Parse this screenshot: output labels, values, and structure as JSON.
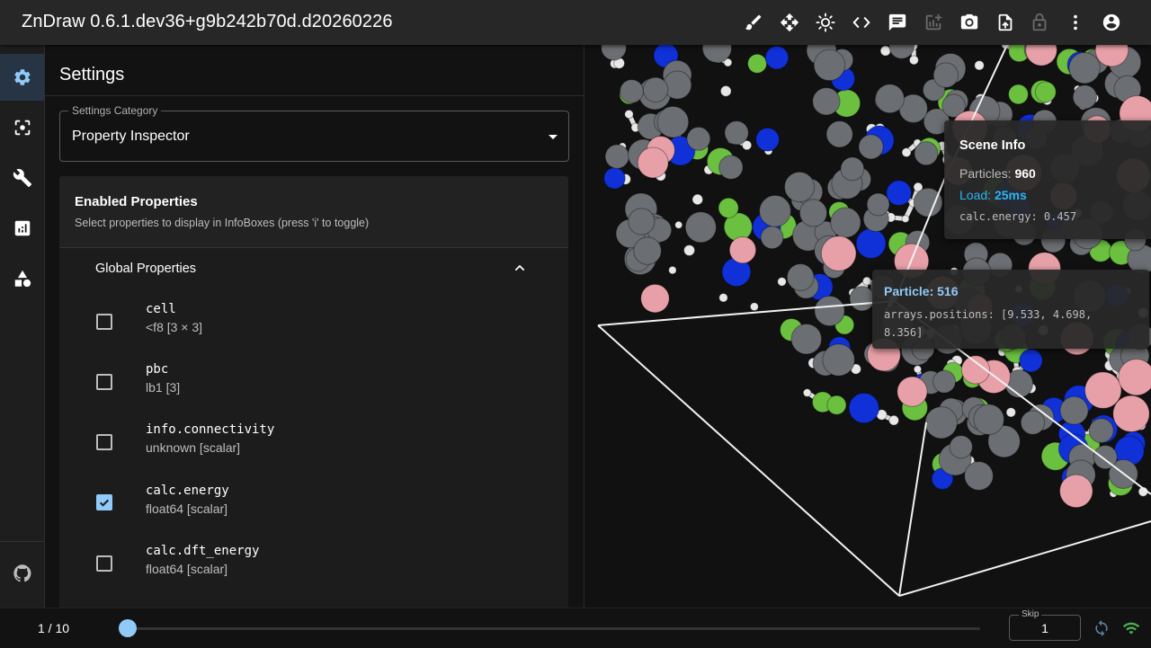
{
  "app": {
    "title": "ZnDraw 0.6.1.dev36+g9b242b70d.d20260226"
  },
  "toolbar": {
    "icons": [
      "brush-icon",
      "move-icon",
      "brightness-icon",
      "code-icon",
      "chat-icon",
      "add-chart-icon",
      "camera-icon",
      "upload-icon",
      "lock-icon",
      "more-vert-icon",
      "account-icon"
    ]
  },
  "rail": {
    "items": [
      "settings-icon",
      "center-focus-icon",
      "wrench-icon",
      "analytics-icon",
      "shapes-icon"
    ],
    "bottom": "github-icon"
  },
  "settings": {
    "title": "Settings",
    "category_label": "Settings Category",
    "category_value": "Property Inspector",
    "card_title": "Enabled Properties",
    "card_subtitle": "Select properties to display in InfoBoxes (press 'i' to toggle)",
    "section_title": "Global Properties",
    "properties": [
      {
        "name": "cell",
        "type": "<f8 [3 × 3]",
        "checked": false
      },
      {
        "name": "pbc",
        "type": "lb1 [3]",
        "checked": false
      },
      {
        "name": "info.connectivity",
        "type": "unknown [scalar]",
        "checked": false
      },
      {
        "name": "calc.energy",
        "type": "float64 [scalar]",
        "checked": true
      },
      {
        "name": "calc.dft_energy",
        "type": "float64 [scalar]",
        "checked": false
      }
    ]
  },
  "scene_info": {
    "title": "Scene Info",
    "particles_label": "Particles:",
    "particles_value": "960",
    "load_label": "Load:",
    "load_value": "25ms",
    "energy_line": "calc.energy: 0.457"
  },
  "particle_info": {
    "title": "Particle: 516",
    "positions": "arrays.positions: [9.533, 4.698, 8.356]"
  },
  "player": {
    "frame": "1 / 10",
    "progress": 0.0,
    "skip_label": "Skip",
    "skip_value": "1"
  },
  "colors": {
    "accent": "#90caf9",
    "load": "#29b6f6",
    "carbon": "#6b6e72",
    "nitrogen": "#1030d8",
    "hydrogen": "#e8e8e8",
    "boron": "#e8a0a8",
    "chlorine": "#6cc040",
    "wifi": "#4caf50"
  }
}
